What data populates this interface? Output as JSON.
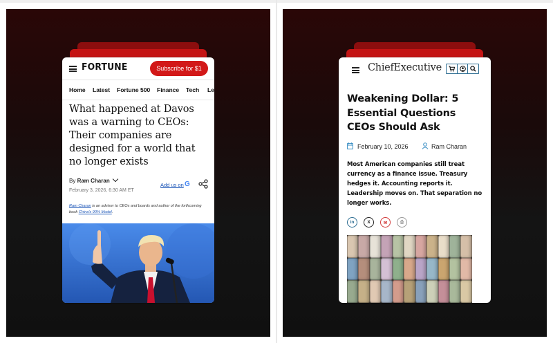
{
  "fortune": {
    "logo": "FORTUNE",
    "subscribe": "Subscribe for $1",
    "nav": [
      "Home",
      "Latest",
      "Fortune 500",
      "Finance",
      "Tech",
      "Le"
    ],
    "headline": "What happened at Davos was a warning to CEOs: Their companies are designed for a world that no longer exists",
    "byline_prefix": "By",
    "author": "Ram Charan",
    "date": "February 3, 2026, 6:30 AM ET",
    "add_us": "Add us on",
    "google_glyph": "G",
    "note_author": "Ram Charan",
    "note_text": " is an adviser to CEOs and boards and author of the forthcoming book ",
    "note_book": "China's 90% Model",
    "note_end": ".",
    "icons": [
      "menu-icon",
      "chevron-down-icon",
      "google-icon",
      "share-icon"
    ],
    "colors": {
      "accent": "#d21818",
      "link": "#1b55b7"
    }
  },
  "chief": {
    "logo": "ChiefExecutive",
    "title": "Weakening Dollar: 5 Essential Questions CEOs Should Ask",
    "date": "February 10, 2026",
    "author": "Ram Charan",
    "body": "Most American companies still treat currency as a finance issue. Treasury hedges it. Accounting reports it. Leadership moves on. That separation no longer works.",
    "share": [
      {
        "label": "in",
        "icon": "linkedin-icon"
      },
      {
        "label": "X",
        "icon": "x-icon"
      },
      {
        "label": "✉",
        "icon": "email-icon"
      },
      {
        "label": "⎙",
        "icon": "print-icon"
      }
    ],
    "header_icons": [
      "cart-icon",
      "account-icon",
      "search-icon"
    ],
    "colors": {
      "accent": "#2d6d92"
    }
  }
}
